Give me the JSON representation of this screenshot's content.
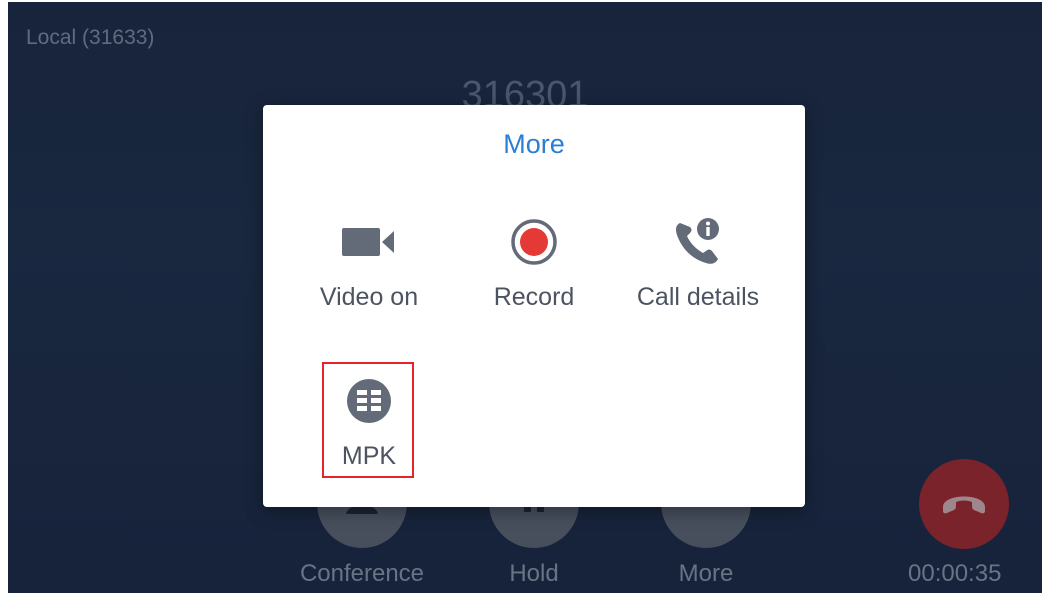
{
  "call": {
    "account_label": "Local (31633)",
    "remote_number": "316301",
    "timer": "00:00:35"
  },
  "bottom_bar": {
    "conference_label": "Conference",
    "hold_label": "Hold",
    "more_label": "More"
  },
  "dialog": {
    "title": "More",
    "items": [
      {
        "label": "Video on",
        "icon": "video-camera-icon"
      },
      {
        "label": "Record",
        "icon": "record-icon"
      },
      {
        "label": "Call details",
        "icon": "phone-info-icon"
      },
      {
        "label": "MPK",
        "icon": "mpk-grid-icon"
      }
    ]
  },
  "colors": {
    "accent_title": "#2a7fd4",
    "record_red": "#e53935",
    "icon_gray": "#646b78",
    "end_call_red": "#b2292c",
    "highlight_red": "#e3242b"
  }
}
